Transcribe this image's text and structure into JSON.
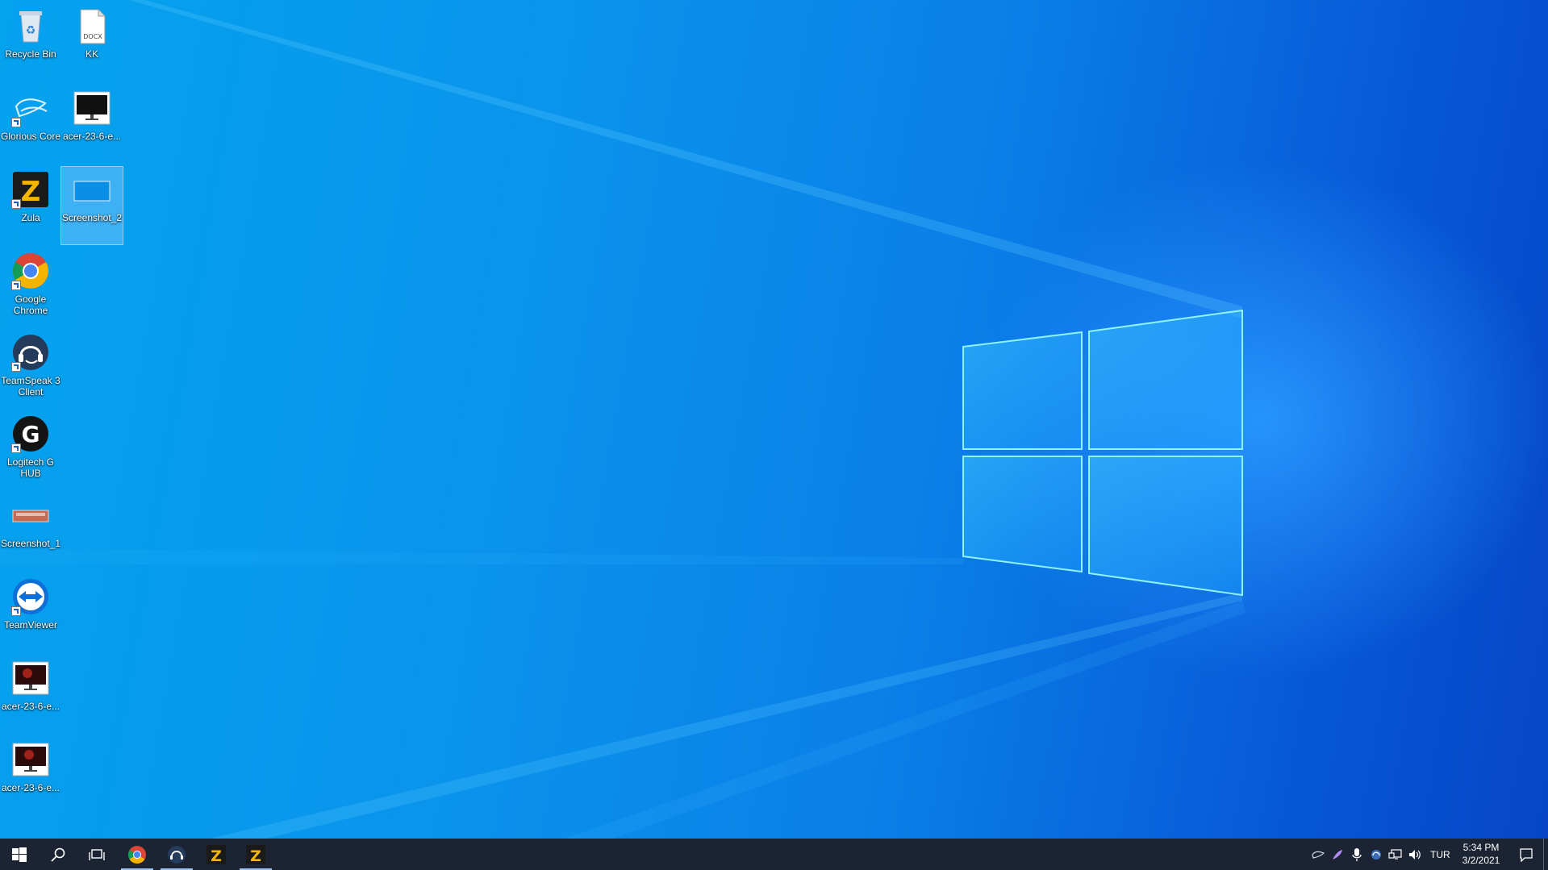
{
  "desktop": {
    "icons": [
      {
        "label": "Recycle Bin"
      },
      {
        "label": "KK",
        "badge": "DOCX"
      },
      {
        "label": "Glorious Core"
      },
      {
        "label": "acer-23-6-e..."
      },
      {
        "label": "Zula"
      },
      {
        "label": "Screenshot_2"
      },
      {
        "label": "Google Chrome"
      },
      {
        "label": "TeamSpeak 3 Client"
      },
      {
        "label": "Logitech G HUB"
      },
      {
        "label": "Screenshot_1"
      },
      {
        "label": "TeamViewer"
      },
      {
        "label": "acer-23-6-e..."
      },
      {
        "label": "acer-23-6-e..."
      }
    ]
  },
  "taskbar": {
    "buttons": [
      "start-icon",
      "search-icon",
      "task-view-icon",
      "chrome-icon",
      "teamspeak-icon",
      "zula-icon",
      "zula-icon"
    ],
    "tray": {
      "language": "TUR",
      "time": "5:34 PM",
      "date": "3/2/2021"
    }
  },
  "colors": {
    "wallpaper_light": "#04a3ee",
    "wallpaper_dark": "#0646c6",
    "taskbar": "#1c2433",
    "logo_edge": "#8ff3ff"
  }
}
